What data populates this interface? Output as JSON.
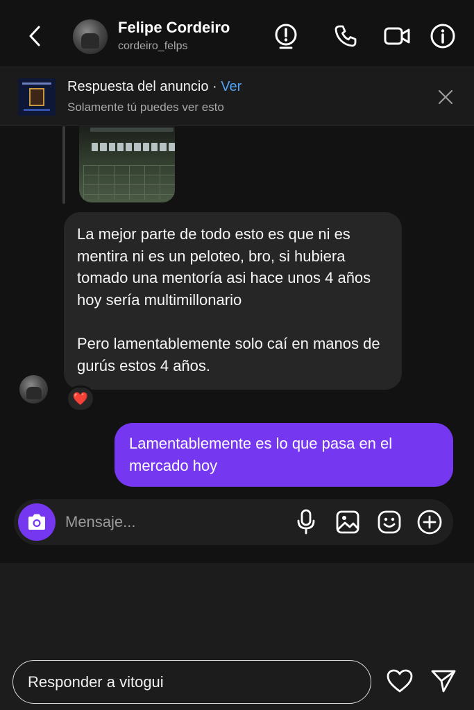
{
  "header": {
    "contact_name": "Felipe Cordeiro",
    "contact_username": "cordeiro_felps",
    "icons": [
      "back-arrow",
      "alert-icon",
      "phone-icon",
      "video-icon",
      "info-icon"
    ]
  },
  "ad_banner": {
    "title": "Respuesta del anuncio",
    "separator": "·",
    "link": "Ver",
    "subtitle": "Solamente tú puedes ver esto"
  },
  "messages": [
    {
      "direction": "incoming",
      "paragraphs": [
        "La mejor parte de todo esto es que ni es mentira ni es un peloteo, bro, si hubiera tomado una mentoría asi hace unos 4 años hoy sería multimillonario",
        "Pero lamentablemente solo caí en manos de gurús estos 4 años."
      ],
      "reaction": "❤️"
    },
    {
      "direction": "outgoing",
      "text": "Lamentablemente es lo que pasa en el mercado hoy"
    }
  ],
  "composer": {
    "placeholder": "Mensaje...",
    "icons": [
      "camera-icon",
      "microphone-icon",
      "gallery-icon",
      "sticker-icon",
      "plus-icon"
    ]
  },
  "footer": {
    "reply_placeholder": "Responder a vitogui",
    "icons": [
      "heart-icon",
      "send-icon"
    ]
  },
  "colors": {
    "background": "#121212",
    "incoming_bubble": "#262626",
    "outgoing_bubble": "#7537f0",
    "link": "#4fa3f7"
  }
}
